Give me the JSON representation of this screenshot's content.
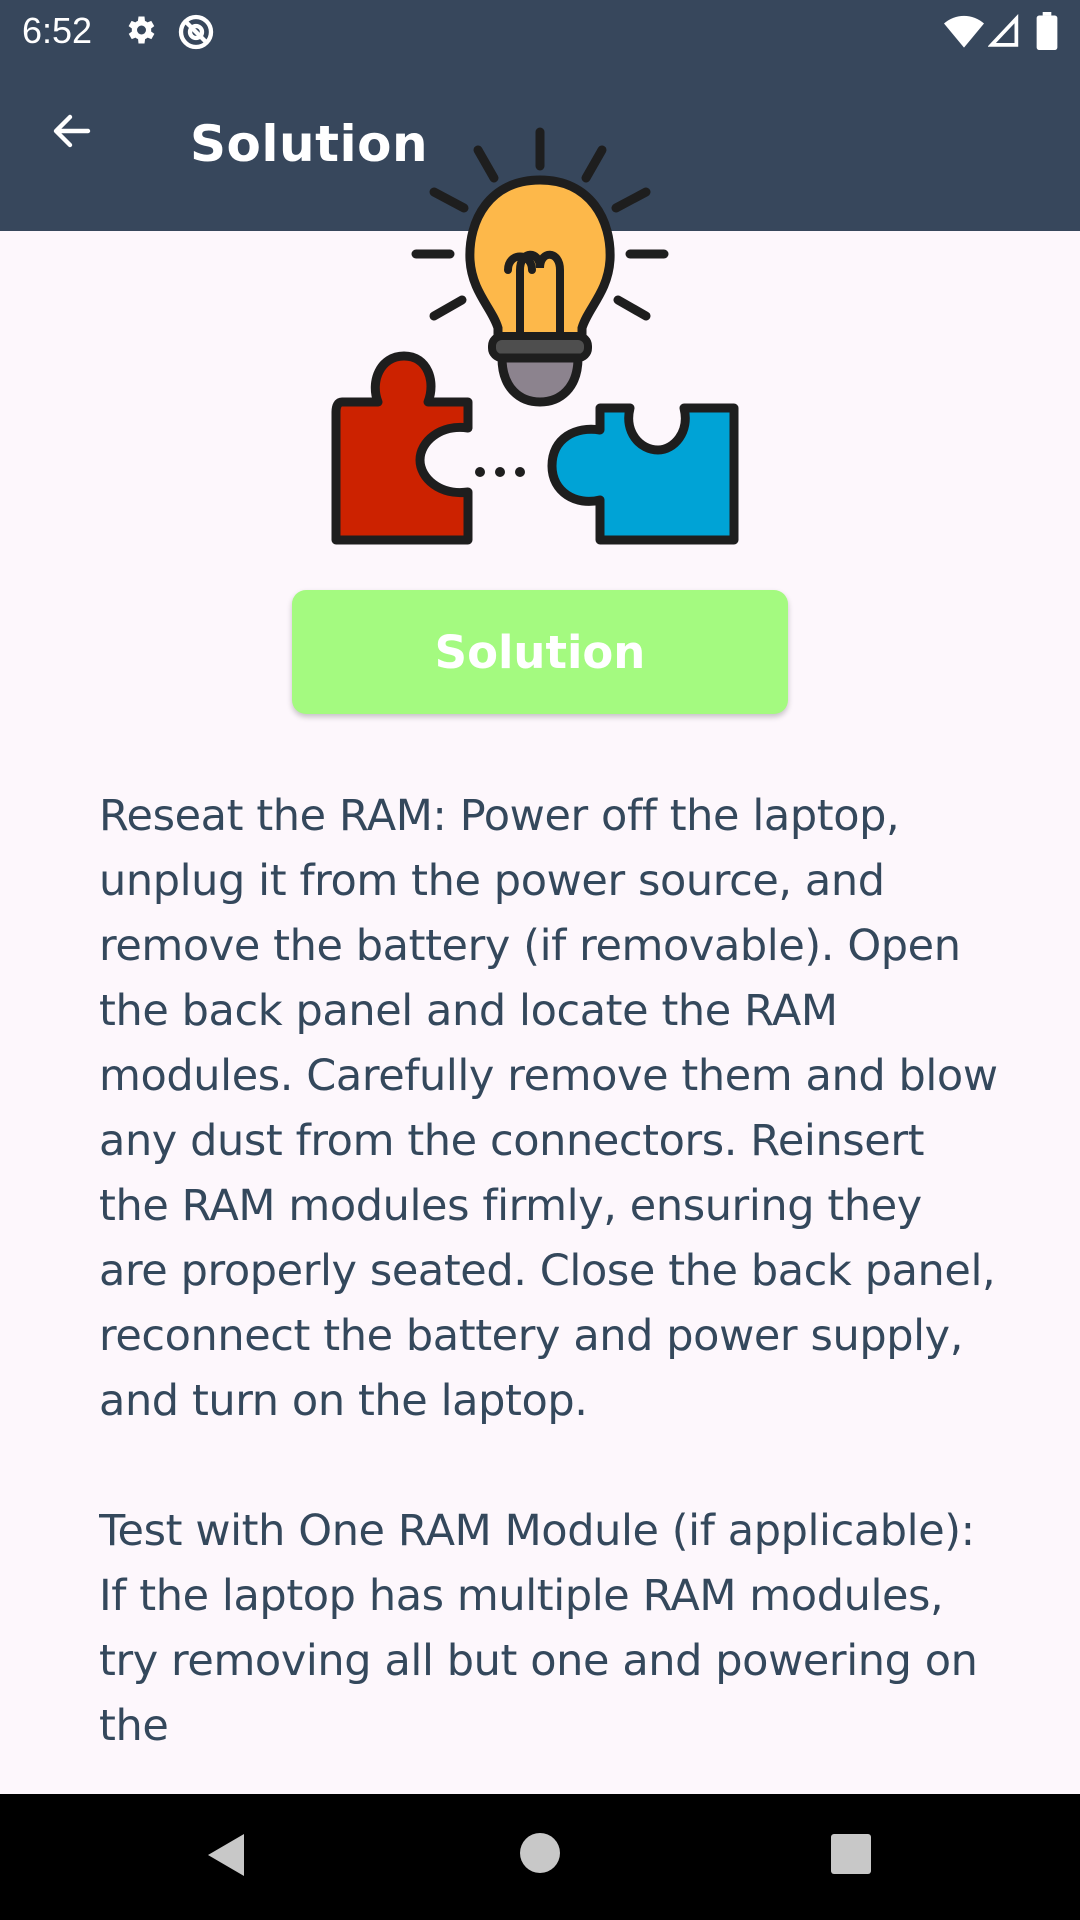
{
  "status_bar": {
    "time": "6:52",
    "icons": [
      "gear-icon",
      "at-sign-icon",
      "wifi-icon",
      "signal-icon",
      "battery-icon"
    ]
  },
  "app_bar": {
    "title": "Solution",
    "back_icon": "arrow-back-icon"
  },
  "illustration": {
    "icon": "lightbulb-puzzle-icon",
    "colors": {
      "bulb": "#fdb84a",
      "red_piece": "#cc2200",
      "blue_piece": "#00a3d6"
    }
  },
  "solution_button": {
    "label": "Solution",
    "color": "#a4fa80"
  },
  "content": {
    "paragraphs": [
      "Reseat the RAM: Power off the laptop, unplug it from the power source, and remove the battery (if removable). Open the back panel and locate the RAM modules. Carefully remove them and blow any dust from the connectors. Reinsert the RAM modules firmly, ensuring they are properly seated. Close the back panel, reconnect the battery and power supply, and turn on the laptop.",
      "Test with One RAM Module (if applicable): If the laptop has multiple RAM modules, try removing all but one and powering on the"
    ]
  },
  "nav_bar": {
    "buttons": [
      "back-triangle-icon",
      "home-circle-icon",
      "recents-square-icon"
    ]
  },
  "theme": {
    "primary": "#37475c",
    "background": "#fdf7fc",
    "text": "#34485c"
  }
}
